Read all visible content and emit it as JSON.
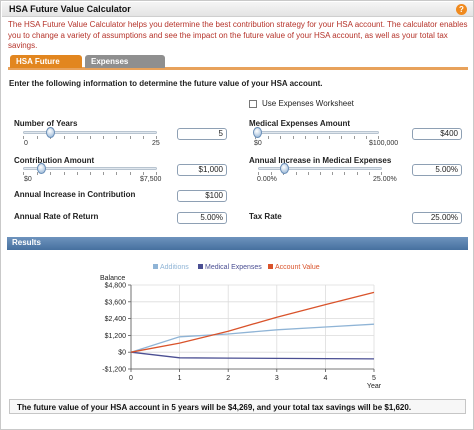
{
  "header": {
    "title": "HSA Future Value Calculator",
    "help_icon": "question-icon"
  },
  "intro": "The HSA Future Value Calculator helps you determine the best contribution strategy for your HSA account. The calculator enables you to change a variety of assumptions and see the impact on the future value of your HSA account, as well as your total tax savings.",
  "tabs": [
    {
      "label": "HSA Future Value",
      "active": true
    },
    {
      "label": "Expenses Worksheet",
      "active": false
    }
  ],
  "form": {
    "heading": "Enter the following information to determine the future value of your HSA account.",
    "use_worksheet_label": "Use Expenses Worksheet",
    "use_worksheet_checked": false,
    "years": {
      "label": "Number of Years",
      "min": "0",
      "max": "25",
      "value": "5",
      "fraction": 0.2
    },
    "medical_expenses": {
      "label": "Medical Expenses Amount",
      "min": "$0",
      "max": "$100,000",
      "value": "$400",
      "fraction": 0.004
    },
    "contribution": {
      "label": "Contribution Amount",
      "min": "$0",
      "max": "$7,500",
      "value": "$1,000",
      "fraction": 0.133
    },
    "medical_increase": {
      "label": "Annual Increase in Medical Expenses",
      "min": "0.00%",
      "max": "25.00%",
      "value": "5.00%",
      "fraction": 0.2
    },
    "contribution_increase": {
      "label": "Annual Increase in Contribution",
      "value": "$100"
    },
    "rate_of_return": {
      "label": "Annual Rate of Return",
      "value": "5.00%"
    },
    "tax_rate": {
      "label": "Tax Rate",
      "value": "25.00%"
    }
  },
  "results": {
    "title": "Results",
    "summary": "The future value of your HSA account in 5 years will be $4,269, and your total tax savings will be $1,620."
  },
  "colors": {
    "additions": "#8fb4d6",
    "medical": "#4b4f93",
    "account": "#d9532b",
    "accent_tab": "#e2861f",
    "results_bar": "#46709f"
  },
  "chart_data": {
    "type": "line",
    "ylabel": "Balance",
    "xlabel": "Year",
    "x": [
      0,
      1,
      2,
      3,
      4,
      5
    ],
    "x_ticks": [
      "0",
      "1",
      "2",
      "3",
      "4",
      "5"
    ],
    "y_ticks": [
      "$4,800",
      "$3,600",
      "$2,400",
      "$1,200",
      "$0",
      "-$1,200"
    ],
    "ylim": [
      -1200,
      4800
    ],
    "grid": true,
    "legend": "top",
    "series": [
      {
        "name": "Additions",
        "values": [
          0,
          1100,
          1300,
          1600,
          1800,
          2000
        ]
      },
      {
        "name": "Medical Expenses",
        "values": [
          0,
          -400,
          -420,
          -440,
          -460,
          -480
        ]
      },
      {
        "name": "Account Value",
        "values": [
          0,
          650,
          1500,
          2500,
          3400,
          4269
        ]
      }
    ]
  }
}
